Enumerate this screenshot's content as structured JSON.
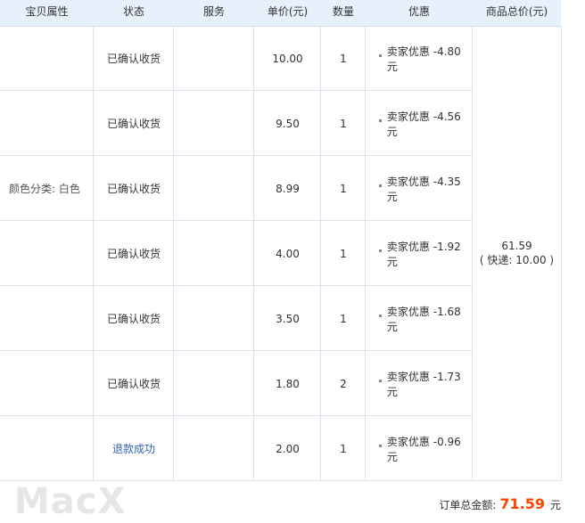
{
  "header": {
    "columns": [
      "宝贝属性",
      "状态",
      "服务",
      "单价(元)",
      "数量",
      "优惠",
      "商品总价(元)"
    ]
  },
  "rows": [
    {
      "attr": "",
      "status": "已确认收货",
      "service": "",
      "price": "10.00",
      "qty": "1",
      "discount": "卖家优惠 -4.80 元"
    },
    {
      "attr": "",
      "status": "已确认收货",
      "service": "",
      "price": "9.50",
      "qty": "1",
      "discount": "卖家优惠 -4.56 元"
    },
    {
      "attr": "颜色分类: 白色",
      "status": "已确认收货",
      "service": "",
      "price": "8.99",
      "qty": "1",
      "discount": "卖家优惠 -4.35 元"
    },
    {
      "attr": "",
      "status": "已确认收货",
      "service": "",
      "price": "4.00",
      "qty": "1",
      "discount": "卖家优惠 -1.92 元"
    },
    {
      "attr": "",
      "status": "已确认收货",
      "service": "",
      "price": "3.50",
      "qty": "1",
      "discount": "卖家优惠 -1.68 元"
    },
    {
      "attr": "",
      "status": "已确认收货",
      "service": "",
      "price": "1.80",
      "qty": "2",
      "discount": "卖家优惠 -1.73 元"
    },
    {
      "attr": "",
      "status": "退款成功",
      "service": "",
      "price": "2.00",
      "qty": "1",
      "discount": "卖家优惠 -0.96 元"
    }
  ],
  "total": {
    "amount": "61.59",
    "shipping": "( 快递: 10.00 )"
  },
  "order_total": {
    "label": "订单总金额:",
    "amount": "71.59",
    "unit": "元"
  },
  "watermark": "MacX",
  "colors": {
    "header_bg": "#e7f1fb",
    "link": "#2f5fb3",
    "amount": "#ff4400"
  }
}
